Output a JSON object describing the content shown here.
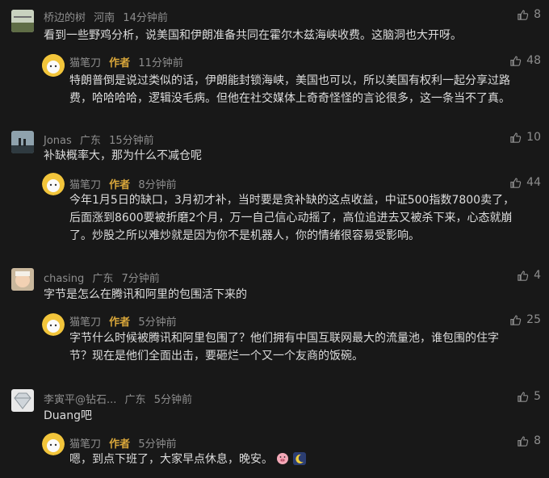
{
  "comments": [
    {
      "user": "桥边的树",
      "region": "河南",
      "time": "14分钟前",
      "likes": "8",
      "text": "看到一些野鸡分析，说美国和伊朗准备共同在霍尔木兹海峡收费。这脑洞也大开呀。",
      "reply": {
        "user": "猫笔刀",
        "badge": "作者",
        "time": "11分钟前",
        "likes": "48",
        "lines": [
          "特朗普倒是说过类似的话，伊朗能封锁海峡，美国也可以，所以美国有权利一起分享过路",
          "费，哈哈哈哈，逻辑没毛病。但他在社交媒体上奇奇怪怪的言论很多，这一条当不了真。"
        ]
      }
    },
    {
      "user": "Jonas",
      "region": "广东",
      "time": "15分钟前",
      "likes": "10",
      "text": "补缺概率大，那为什么不减仓呢",
      "reply": {
        "user": "猫笔刀",
        "badge": "作者",
        "time": "8分钟前",
        "likes": "44",
        "lines": [
          "今年1月5日的缺口，3月初才补，当时要是贪补缺的这点收益，中证500指数7800卖了，",
          "后面涨到8600要被折磨2个月，万一自己信心动摇了，高位追进去又被杀下来，心态就崩",
          "了。炒股之所以难炒就是因为你不是机器人，你的情绪很容易受影响。"
        ]
      }
    },
    {
      "user": "chasing",
      "region": "广东",
      "time": "7分钟前",
      "likes": "4",
      "text": "字节是怎么在腾讯和阿里的包围活下来的",
      "reply": {
        "user": "猫笔刀",
        "badge": "作者",
        "time": "5分钟前",
        "likes": "25",
        "lines": [
          "字节什么时候被腾讯和阿里包围了？他们拥有中国互联网最大的流量池，谁包围的住字",
          "节？现在是他们全面出击，要砸烂一个又一个友商的饭碗。"
        ]
      }
    },
    {
      "user": "李寅平@钻石...",
      "region": "广东",
      "time": "5分钟前",
      "likes": "5",
      "text": "Duang吧",
      "reply": {
        "user": "猫笔刀",
        "badge": "作者",
        "time": "5分钟前",
        "likes": "8",
        "lines": [
          "嗯，到点下班了，大家早点休息，晚安。"
        ],
        "emoji": [
          "pig-face-icon",
          "crescent-moon-icon"
        ]
      }
    }
  ]
}
